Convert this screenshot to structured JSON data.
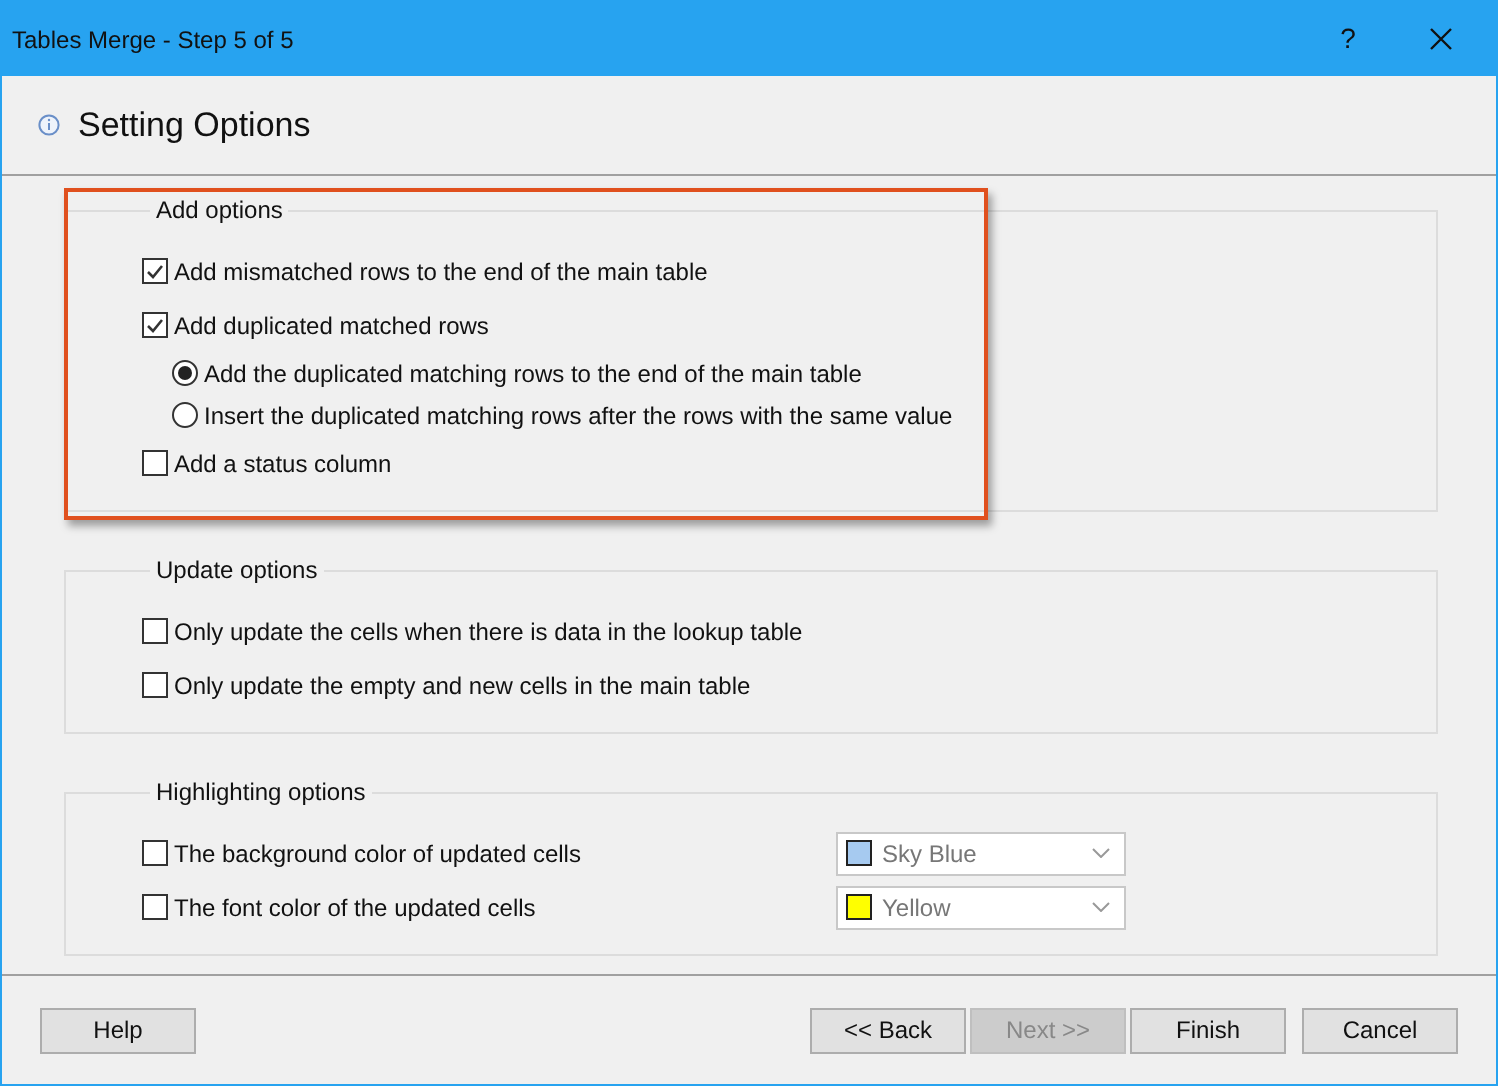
{
  "window": {
    "title": "Tables Merge - Step 5 of 5",
    "help": "?"
  },
  "header": {
    "title": "Setting Options"
  },
  "groups": [
    {
      "title": "Add options",
      "highlighted": true,
      "items": [
        {
          "kind": "checkbox",
          "label": "Add mismatched rows to the end of the main table",
          "checked": true
        },
        {
          "kind": "checkbox",
          "label": "Add duplicated matched rows",
          "checked": true,
          "children": [
            {
              "kind": "radio",
              "label": "Add the duplicated matching rows to the end of the main table",
              "selected": true
            },
            {
              "kind": "radio",
              "label": "Insert the duplicated matching rows after the rows with the same value",
              "selected": false
            }
          ]
        },
        {
          "kind": "checkbox",
          "label": "Add a status column",
          "checked": false
        }
      ]
    },
    {
      "title": "Update options",
      "highlighted": false,
      "items": [
        {
          "kind": "checkbox",
          "label": "Only update the cells when there is data in the lookup table",
          "checked": false
        },
        {
          "kind": "checkbox",
          "label": "Only update the empty and new cells in the main table",
          "checked": false
        }
      ]
    },
    {
      "title": "Highlighting options",
      "highlighted": false,
      "items": [
        {
          "kind": "color",
          "label": "The background color of updated cells",
          "checked": false,
          "dropdown": {
            "value": "Sky Blue",
            "color": "#a6caf0"
          }
        },
        {
          "kind": "color",
          "label": "The font color of the updated cells",
          "checked": false,
          "dropdown": {
            "value": "Yellow",
            "color": "#ffff00"
          }
        }
      ]
    }
  ],
  "buttons": [
    {
      "label": "Help",
      "disabled": false
    },
    {
      "label": "<< Back",
      "disabled": false
    },
    {
      "label": "Next >>",
      "disabled": true
    },
    {
      "label": "Finish",
      "disabled": false
    },
    {
      "label": "Cancel",
      "disabled": false
    }
  ]
}
